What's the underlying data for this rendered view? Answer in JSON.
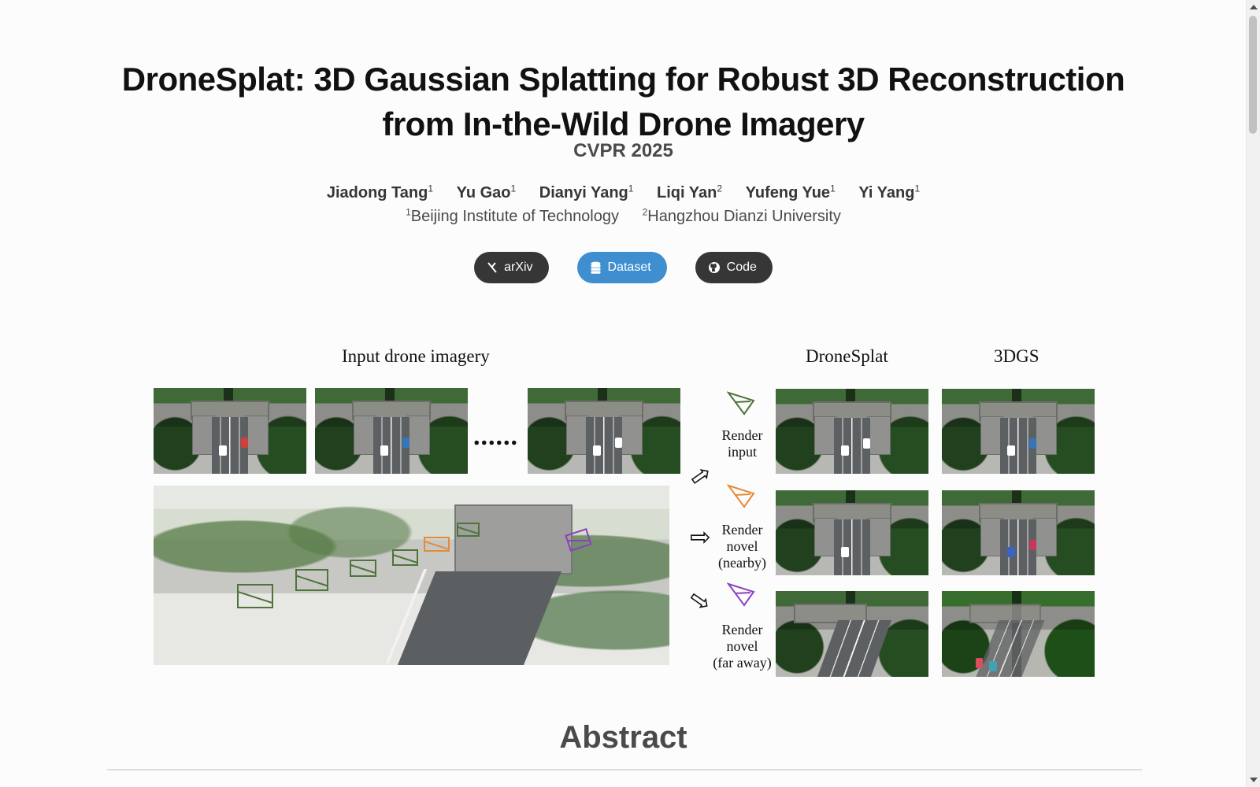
{
  "paper": {
    "title_line_1": "DroneSplat: 3D Gaussian Splatting for Robust 3D Reconstruction",
    "title_line_2": "from In-the-Wild Drone Imagery",
    "venue": "CVPR 2025"
  },
  "authors": [
    {
      "name": "Jiadong Tang",
      "affiliation": "1"
    },
    {
      "name": "Yu Gao",
      "affiliation": "1"
    },
    {
      "name": "Dianyi Yang",
      "affiliation": "1"
    },
    {
      "name": "Liqi Yan",
      "affiliation": "2"
    },
    {
      "name": "Yufeng Yue",
      "affiliation": "1"
    },
    {
      "name": "Yi Yang",
      "affiliation": "1"
    }
  ],
  "affiliations": [
    {
      "number": "1",
      "name": "Beijing Institute of Technology"
    },
    {
      "number": "2",
      "name": "Hangzhou Dianzi University"
    }
  ],
  "buttons": {
    "arxiv_label": "arXiv",
    "dataset_label": "Dataset",
    "code_label": "Code"
  },
  "figure": {
    "input_label": "Input drone imagery",
    "ellipsis": "......",
    "method_label": "DroneSplat",
    "baseline_label": "3DGS",
    "render_input_1": "Render",
    "render_input_2": "input",
    "render_nearby_1": "Render",
    "render_nearby_2": "novel",
    "render_nearby_3": "(nearby)",
    "render_far_1": "Render",
    "render_far_2": "novel",
    "render_far_3": "(far away)"
  },
  "sections": {
    "abstract_heading": "Abstract"
  },
  "colors": {
    "dark_button": "#363636",
    "dataset_button": "#3e8ed0",
    "camera_green": "#4e743a",
    "camera_orange": "#e48a3a",
    "camera_purple": "#8c42bd"
  }
}
